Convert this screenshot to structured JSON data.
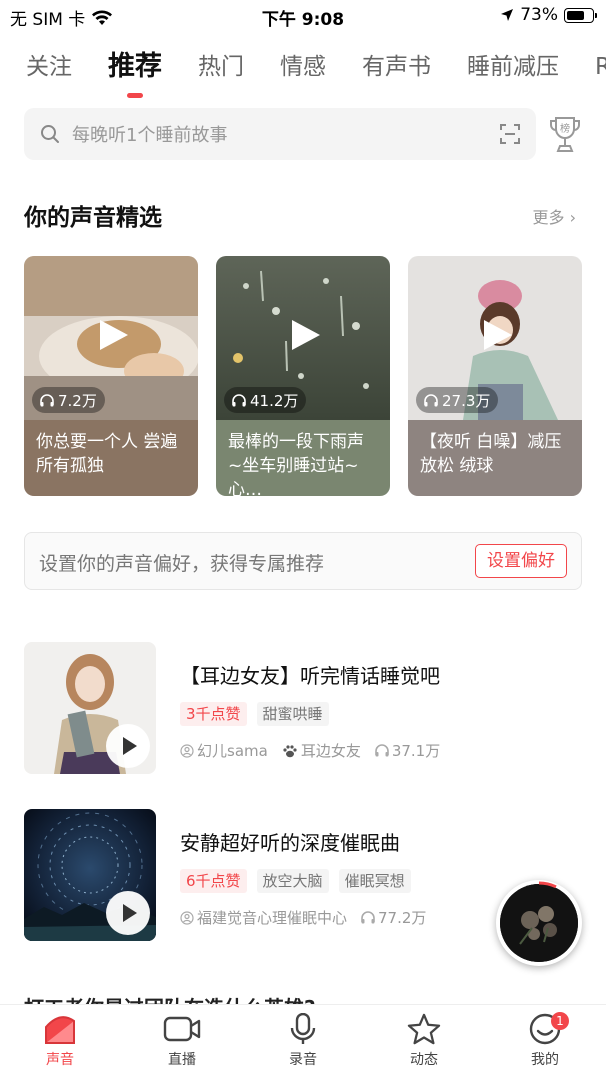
{
  "status_bar": {
    "carrier": "无 SIM 卡",
    "time": "下午 9:08",
    "battery": "73%",
    "battery_level": 0.73
  },
  "tabs": [
    "关注",
    "推荐",
    "热门",
    "情感",
    "有声书",
    "睡前减压",
    "R"
  ],
  "search": {
    "placeholder": "每晚听1个睡前故事"
  },
  "trophy_label": "榜",
  "section": {
    "title": "你的声音精选",
    "more": "更多"
  },
  "cards": [
    {
      "plays": "7.2万",
      "caption": "你总要一个人 尝遍所有孤独",
      "color": "#8a7462"
    },
    {
      "plays": "41.2万",
      "caption": "最棒的一段下雨声~坐车别睡过站~心…",
      "color": "#7a8670"
    },
    {
      "plays": "27.3万",
      "caption": "【夜听 白噪】减压放松 绒球",
      "color": "#8e8480"
    }
  ],
  "preference": {
    "text": "设置你的声音偏好，获得专属推荐",
    "button": "设置偏好"
  },
  "list": [
    {
      "title": "【耳边女友】听完情话睡觉吧",
      "likes": "3千点赞",
      "tags": [
        "甜蜜哄睡"
      ],
      "author": "幻儿sama",
      "album": "耳边女友",
      "plays": "37.1万"
    },
    {
      "title": "安静超好听的深度催眠曲",
      "likes": "6千点赞",
      "tags": [
        "放空大脑",
        "催眠冥想"
      ],
      "author": "福建觉音心理催眠中心",
      "album": "",
      "plays": "77.2万"
    }
  ],
  "peek_title": "打工者你是过团队在造什么英雄?",
  "bottom_nav": [
    {
      "label": "声音",
      "icon": "sound-icon"
    },
    {
      "label": "直播",
      "icon": "live-camera-icon"
    },
    {
      "label": "录音",
      "icon": "microphone-icon"
    },
    {
      "label": "动态",
      "icon": "star-icon"
    },
    {
      "label": "我的",
      "icon": "profile-icon",
      "badge": "1"
    }
  ],
  "colors": {
    "accent": "#f2464a"
  }
}
